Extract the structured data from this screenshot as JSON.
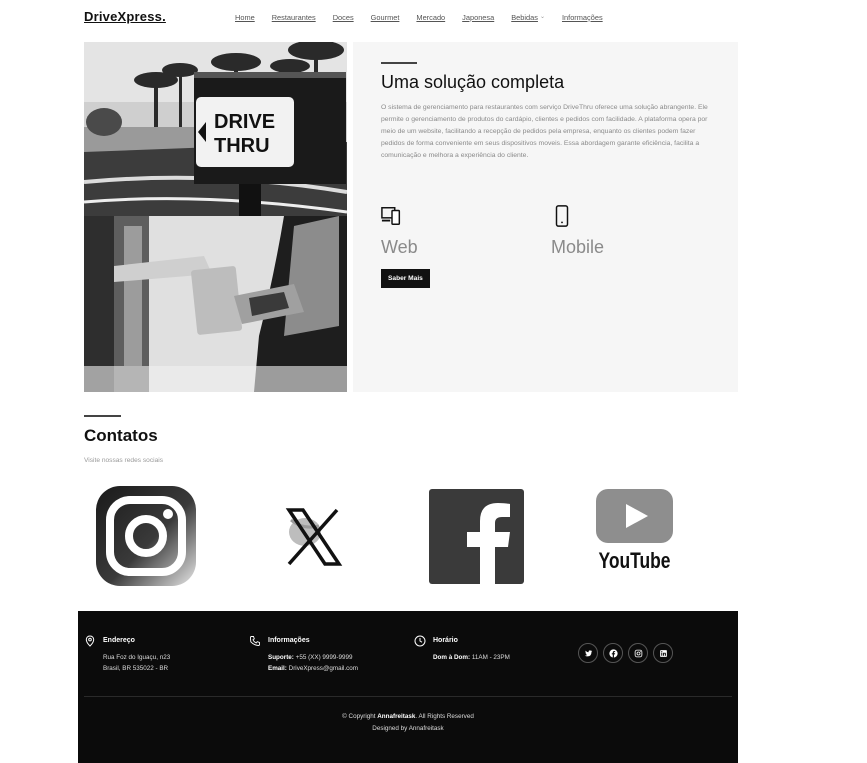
{
  "nav": {
    "logo": "DriveXpress.",
    "items": [
      {
        "label": "Home"
      },
      {
        "label": "Restaurantes"
      },
      {
        "label": "Doces"
      },
      {
        "label": "Gourmet"
      },
      {
        "label": "Mercado"
      },
      {
        "label": "Japonesa"
      },
      {
        "label": "Bebidas"
      },
      {
        "label": "Informações"
      }
    ]
  },
  "hero": {
    "sign_text_1": "DRIVE",
    "sign_text_2": "THRU",
    "title": "Uma solução completa",
    "description": "O sistema de gerenciamento para restaurantes com serviço DriveThru oferece uma solução abrangente. Ele permite o gerenciamento de produtos do cardápio, clientes e pedidos com facilidade. A plataforma opera por meio de um website, facilitando a recepção de pedidos pela empresa, enquanto os clientes podem fazer pedidos de forma conveniente em seus dispositivos moveis. Essa abordagem garante eficiência, facilita a comunicação e melhora a experiência do cliente.",
    "features": [
      {
        "label": "Web",
        "icon": "devices-icon"
      },
      {
        "label": "Mobile",
        "icon": "phone-icon"
      }
    ],
    "button_label": "Saber Mais"
  },
  "contact": {
    "title": "Contatos",
    "subtitle": "Visite nossas redes sociais",
    "youtube_text": "YouTube"
  },
  "footer": {
    "address": {
      "heading": "Endereço",
      "line1": "Rua Foz do Iguaçu, n23",
      "line2": "Brasil, BR 535022 - BR"
    },
    "info": {
      "heading": "Informações",
      "support_label": "Suporte:",
      "support_value": " +55 (XX) 9999-9999",
      "email_label": "Email:",
      "email_value": " DriveXpress@gmail.com"
    },
    "hours": {
      "heading": "Horário",
      "days_label": "Dom à Dom:",
      "days_value": " 11AM - 23PM"
    },
    "copyright_prefix": "© Copyright ",
    "copyright_brand": "Annafreitask",
    "copyright_suffix": ". All Rights Reserved",
    "designed_by": "Designed by Annafreitask"
  },
  "colors": {
    "accent": "#111111",
    "footer_bg": "#0b0b0b",
    "panel_bg": "#f6f6f6",
    "muted_text": "#8a8a8a"
  }
}
